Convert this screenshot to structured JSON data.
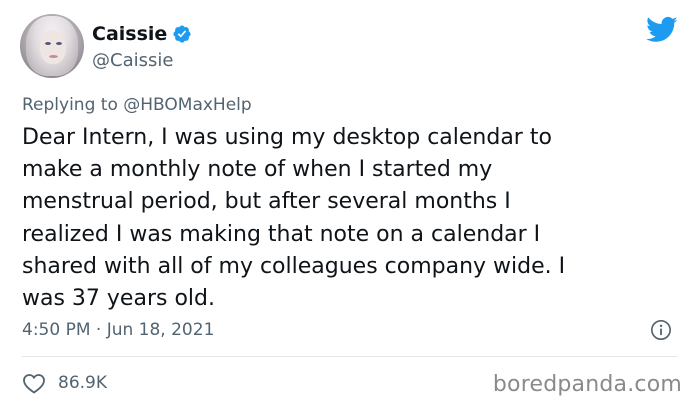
{
  "tweet": {
    "author": {
      "display_name": "Caissie",
      "handle": "@Caissie",
      "verified_icon": "verified-badge-icon",
      "avatar": "avatar"
    },
    "platform_icon": "twitter-bird-icon",
    "reply_context": {
      "prefix": "Replying to",
      "mention": "@HBOMaxHelp"
    },
    "text": "Dear Intern, I was using my desktop calendar to\nmake a monthly note of when I started my\nmenstrual period, but after several months I\nrealized I was making that note on a calendar I\nshared with all of my colleagues company wide. I\nwas 37 years old.",
    "timestamp": "4:50 PM · Jun 18, 2021",
    "info_icon": "info-icon",
    "likes": {
      "icon": "heart-icon",
      "count": "86.9K"
    }
  },
  "watermark": "boredpanda.com",
  "colors": {
    "twitter_blue": "#1d9bf0",
    "text_primary": "#0f1419",
    "text_secondary": "#536471",
    "divider": "#e4e8eb",
    "watermark": "#8a8a8a"
  }
}
